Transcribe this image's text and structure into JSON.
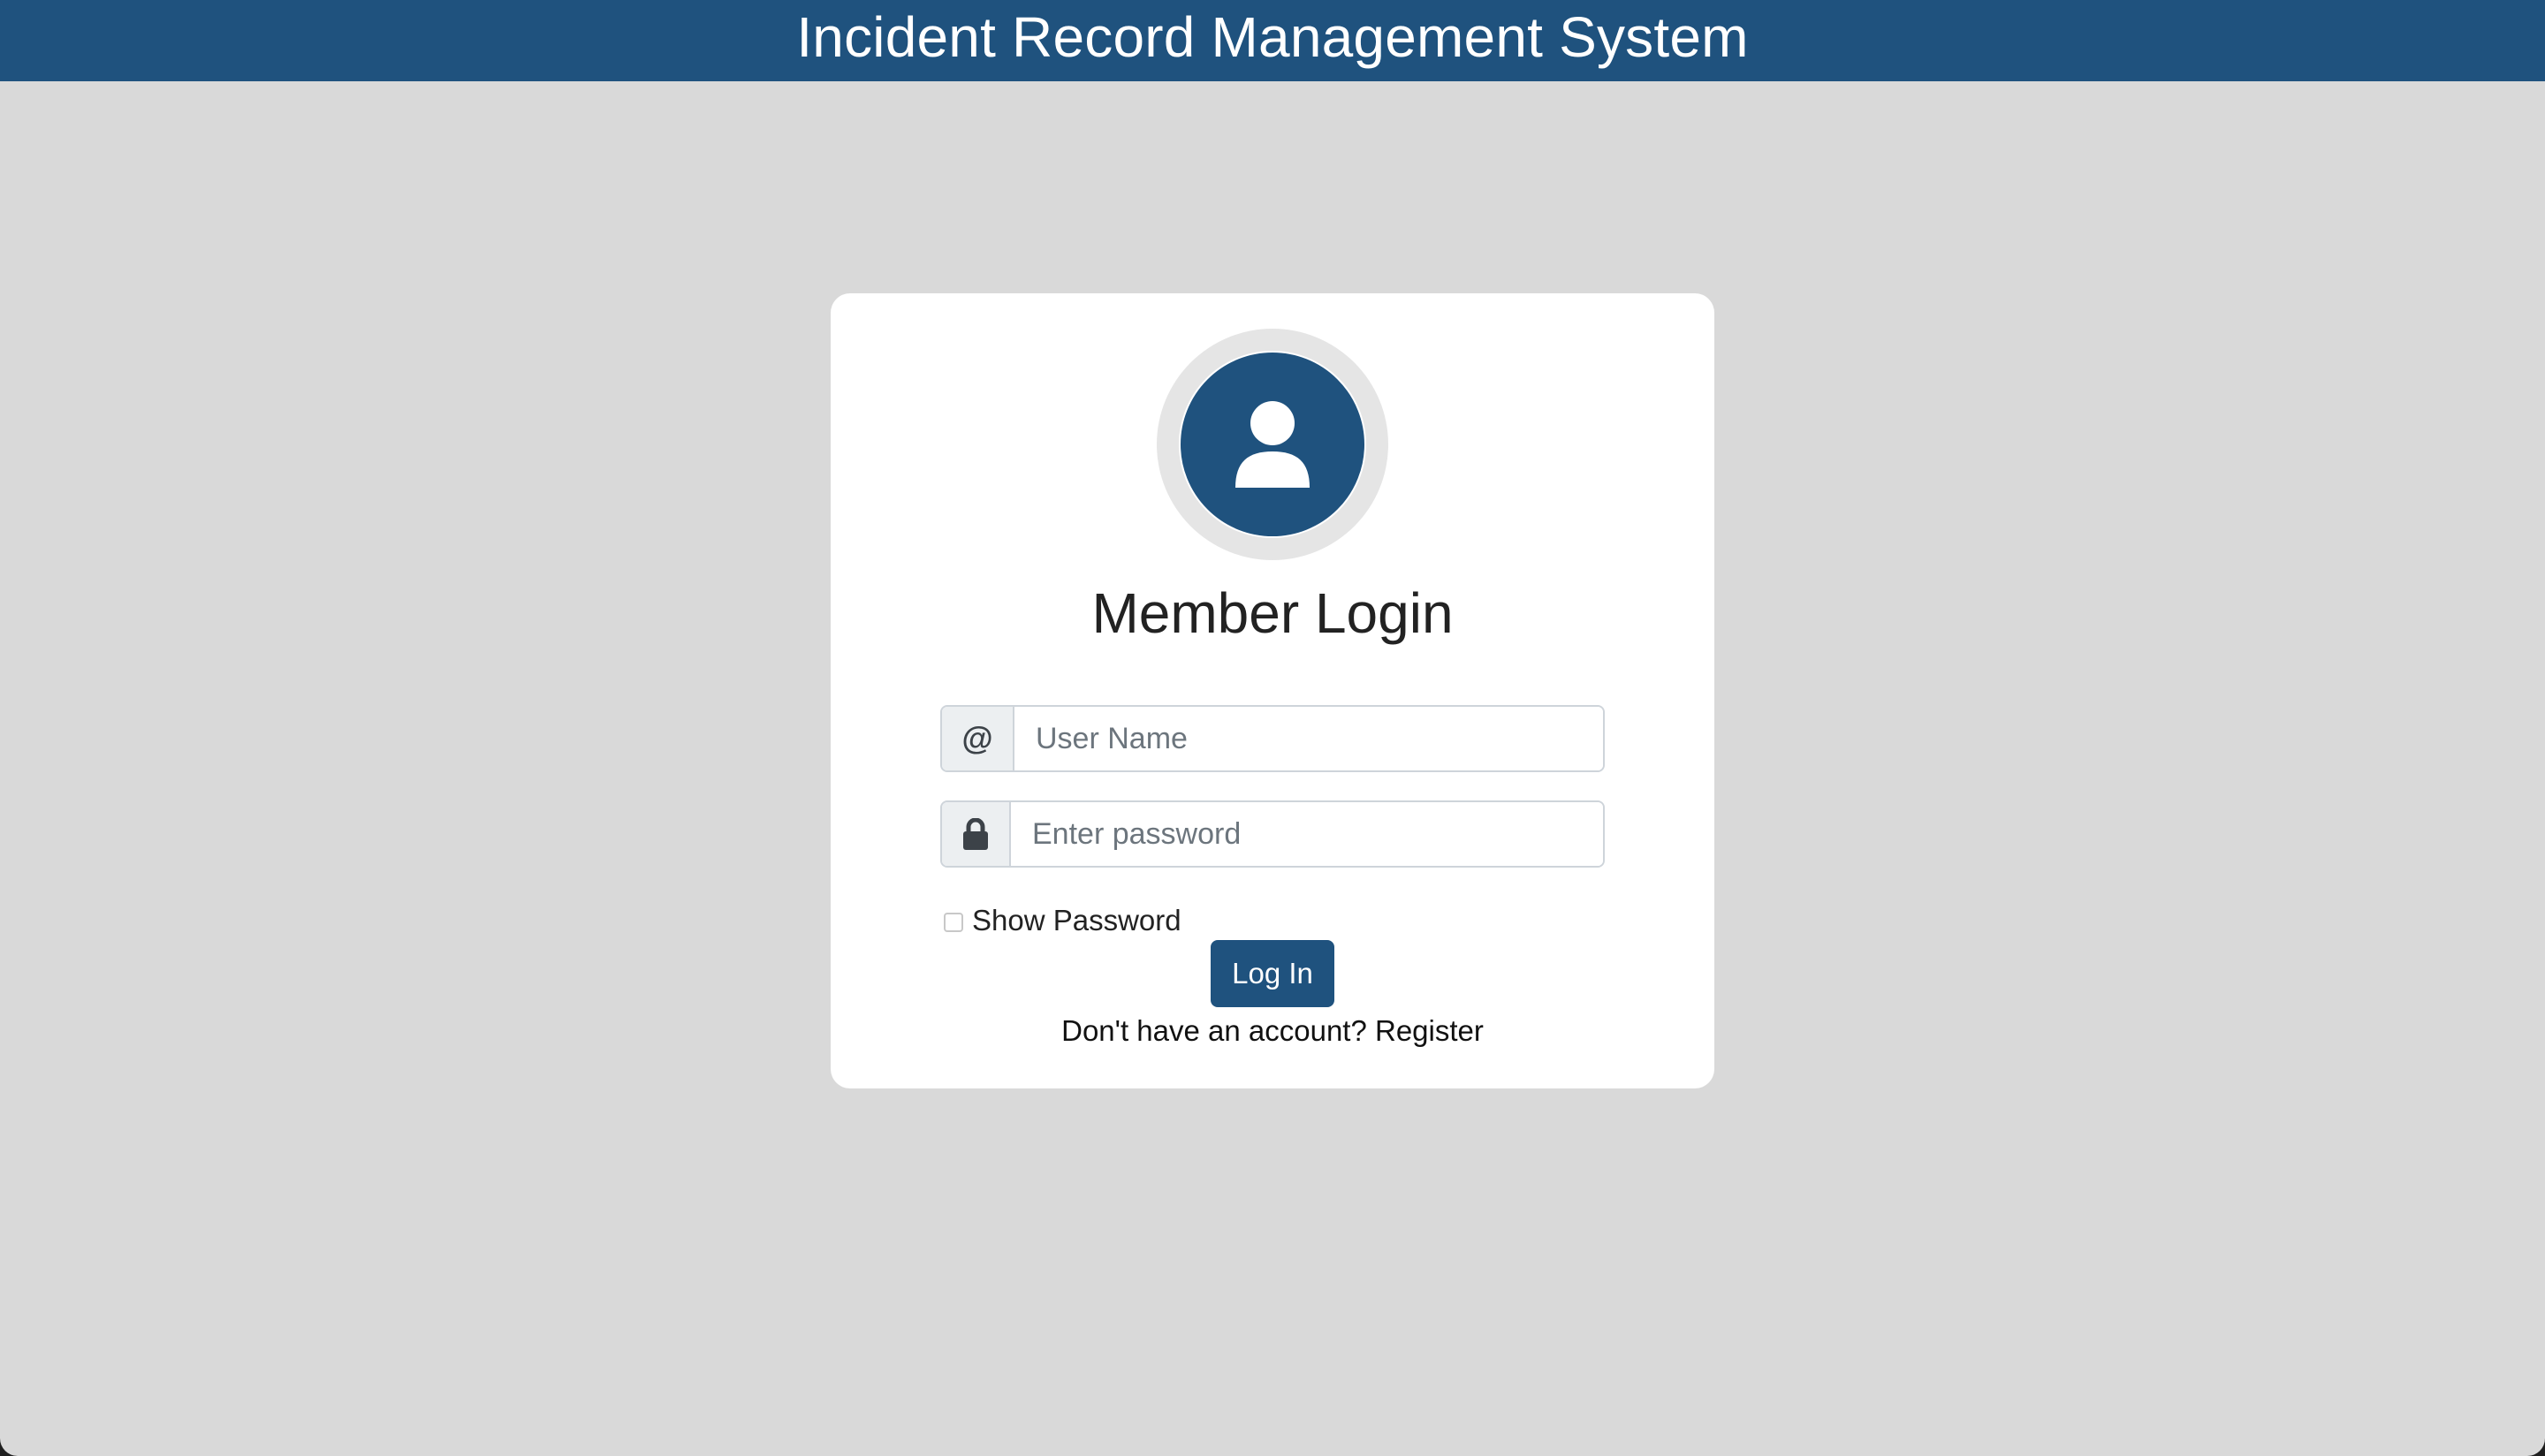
{
  "header": {
    "title": "Incident Record Management System"
  },
  "login_card": {
    "avatar_icon": "user-icon",
    "title": "Member Login",
    "username": {
      "icon": "at-sign-icon",
      "icon_text": "@",
      "placeholder": "User Name",
      "value": ""
    },
    "password": {
      "icon": "lock-icon",
      "placeholder": "Enter password",
      "value": ""
    },
    "show_password": {
      "label": "Show Password",
      "checked": false
    },
    "login_button": "Log In",
    "register_prompt": "Don't have an account?",
    "register_link": "Register"
  },
  "colors": {
    "brand": "#1f527e",
    "background": "#d9d9d9",
    "card": "#ffffff"
  }
}
